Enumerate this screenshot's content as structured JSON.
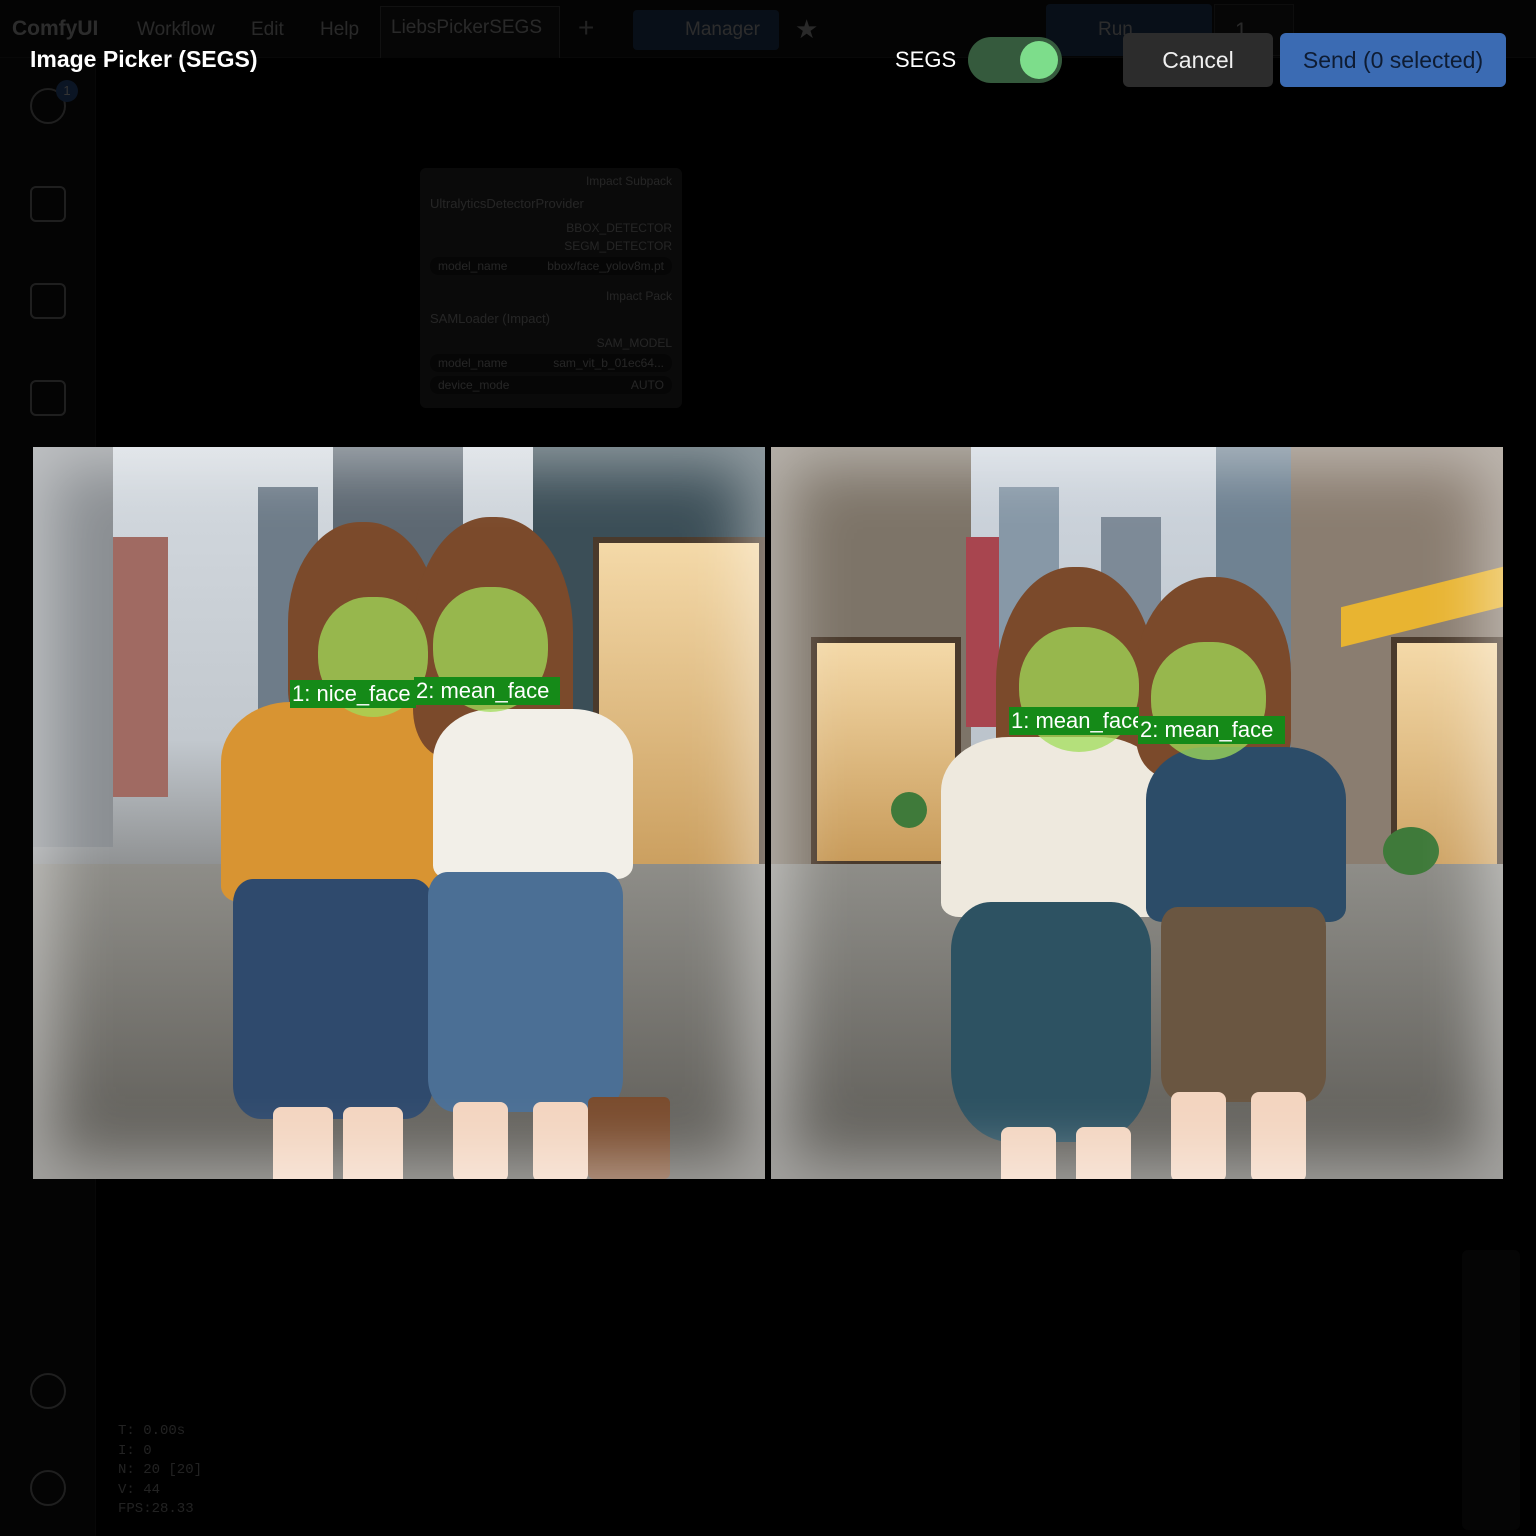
{
  "background_app": {
    "logo": "ComfyUI",
    "menu": [
      "Workflow",
      "Edit",
      "Help"
    ],
    "tab_title": "LiebsPickerSEGS",
    "manager_label": "Manager",
    "run_label": "Run",
    "run_count": "1",
    "queue_badge": "1",
    "nodes": [
      {
        "group": "Impact Subpack",
        "title": "UltralyticsDetectorProvider",
        "outputs": [
          "BBOX_DETECTOR",
          "SEGM_DETECTOR"
        ],
        "widget_name": "model_name",
        "widget_value": "bbox/face_yolov8m.pt"
      },
      {
        "group": "Impact Pack",
        "title": "SAMLoader (Impact)",
        "outputs": [
          "SAM_MODEL"
        ],
        "widget_name": "model_name",
        "widget_value": "sam_vit_b_01ec64...",
        "widget2_name": "device_mode",
        "widget2_value": "AUTO"
      }
    ],
    "stats": [
      "T: 0.00s",
      "I: 0",
      "N: 20 [20]",
      "V: 44",
      "FPS:28.33"
    ]
  },
  "picker": {
    "title": "Image Picker (SEGS)",
    "segs_label": "SEGS",
    "segs_enabled": true,
    "cancel_label": "Cancel",
    "send_label": "Send (0 selected)",
    "accent_colors": {
      "toggle_knob": "#7ddd8b",
      "send_button": "#3b6bb3",
      "segment_label": "#158a18"
    }
  },
  "images": [
    {
      "index": 1,
      "segments": [
        {
          "label": "1: nice_face"
        },
        {
          "label": "2: mean_face"
        }
      ]
    },
    {
      "index": 2,
      "segments": [
        {
          "label": "1: mean_face"
        },
        {
          "label": "2: mean_face"
        }
      ]
    }
  ]
}
